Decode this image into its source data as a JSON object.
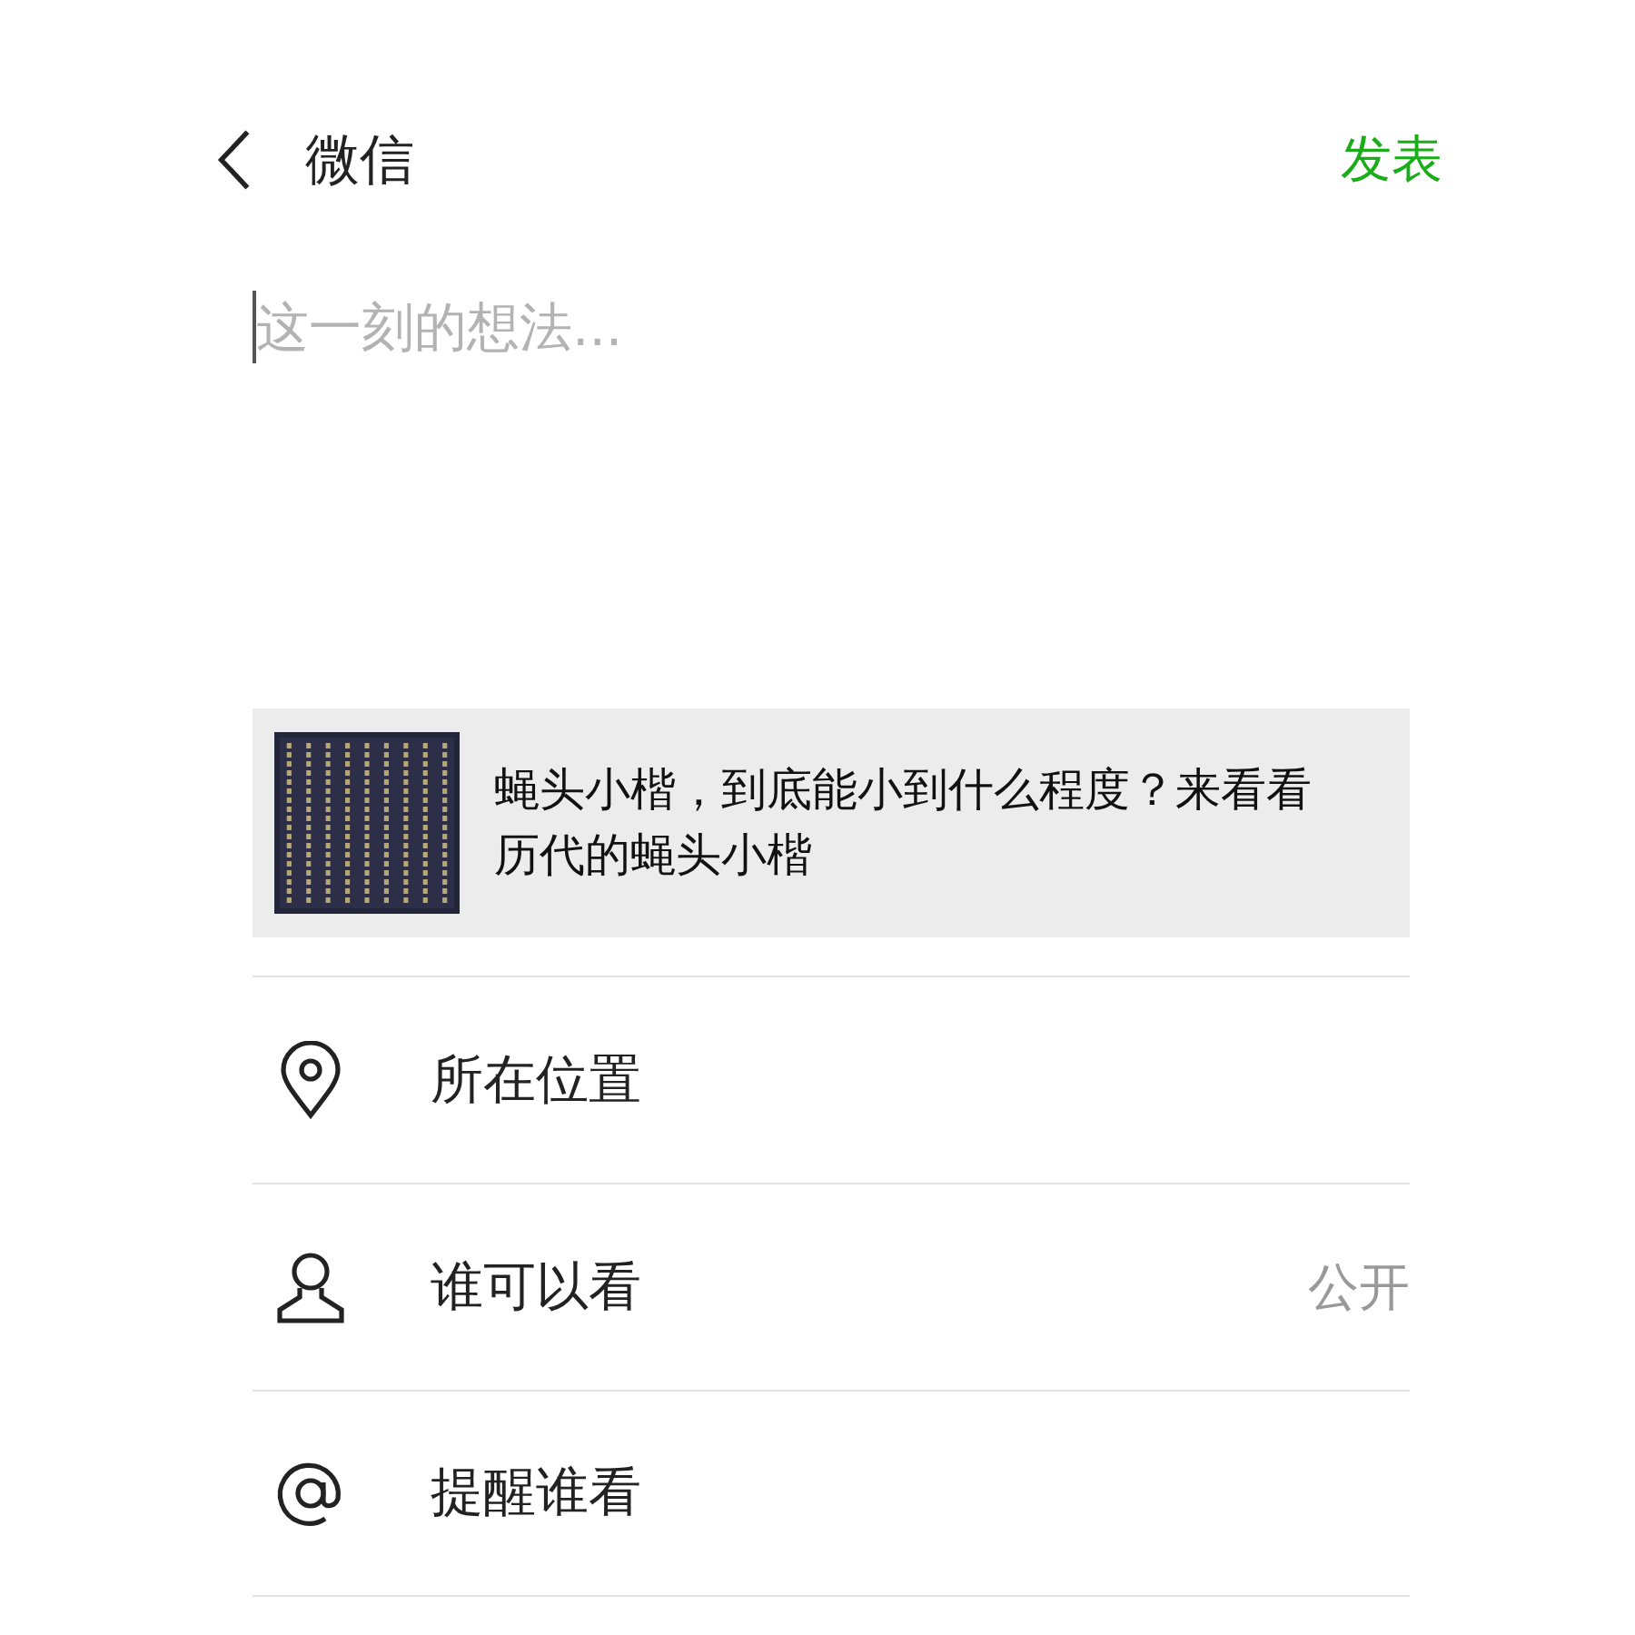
{
  "header": {
    "back_label": "微信",
    "action": "发表"
  },
  "composer": {
    "placeholder": "这一刻的想法..."
  },
  "link_card": {
    "title": "蝇头小楷，到底能小到什么程度？来看看历代的蝇头小楷"
  },
  "options": [
    {
      "kind": "location",
      "label": "所在位置"
    },
    {
      "kind": "visibility",
      "label": "谁可以看",
      "value": "公开"
    },
    {
      "kind": "mention",
      "label": "提醒谁看"
    }
  ]
}
